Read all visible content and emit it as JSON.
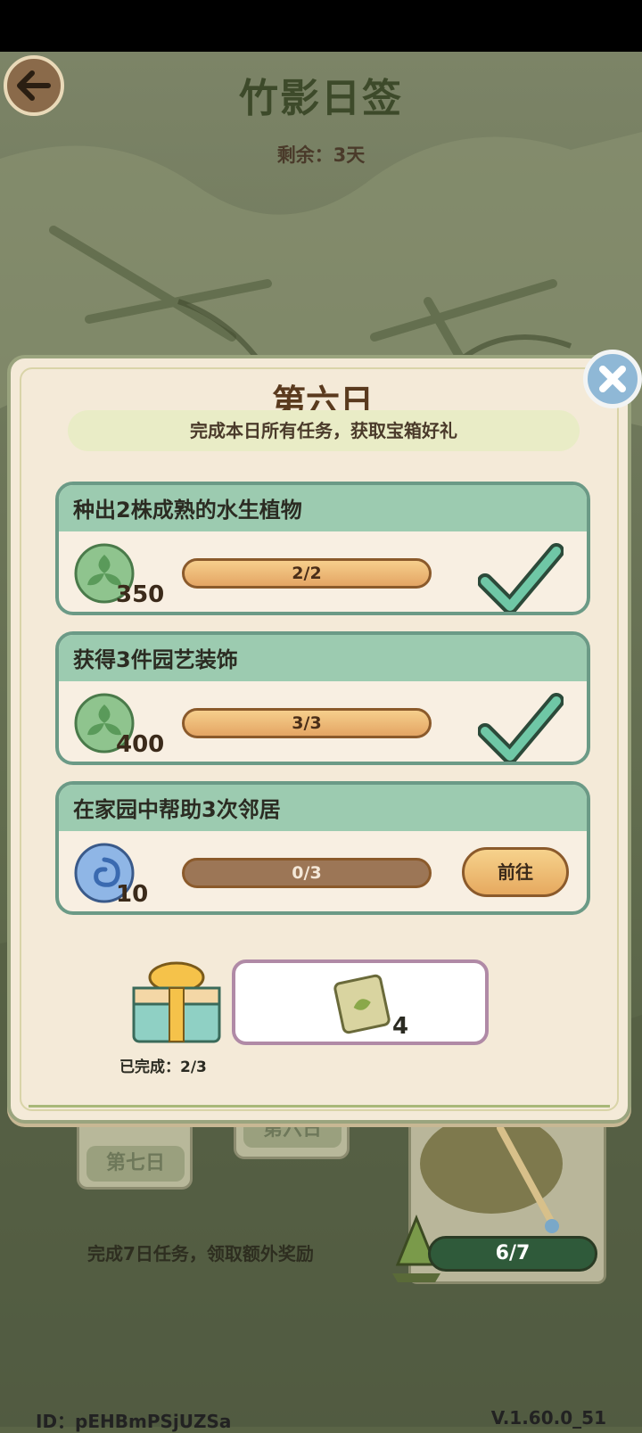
{
  "header": {
    "title": "竹影日签",
    "remaining_label": "剩余：3天"
  },
  "dialog": {
    "title": "第六日",
    "subtitle": "完成本日所有任务，获取宝箱好礼",
    "tasks": [
      {
        "title": "种出2株成熟的水生植物",
        "reward_icon": "leaf-coin-icon",
        "reward_amount": "350",
        "progress_text": "2/2",
        "progress_fraction": 1.0,
        "status": "completed"
      },
      {
        "title": "获得3件园艺装饰",
        "reward_icon": "leaf-coin-icon",
        "reward_amount": "400",
        "progress_text": "3/3",
        "progress_fraction": 1.0,
        "status": "completed"
      },
      {
        "title": "在家园中帮助3次邻居",
        "reward_icon": "swirl-orb-icon",
        "reward_amount": "10",
        "progress_text": "0/3",
        "progress_fraction": 0.0,
        "status": "go",
        "go_label": "前往"
      }
    ],
    "chest": {
      "completed_label": "已完成：2/3",
      "reward_icon": "seed-packet-icon",
      "reward_amount": "4"
    }
  },
  "background": {
    "day_cards": [
      "第七日",
      "第六日"
    ],
    "extra_reward_text": "完成7日任务，领取额外奖励",
    "week_progress": "6/7"
  },
  "footer": {
    "user_id": "ID：pEHBmPSjUZSa",
    "version": "V.1.60.0_51"
  },
  "colors": {
    "accent_green": "#9ccbb0",
    "border_green": "#6b9a86",
    "progress_fill": "#e4a564",
    "check_color": "#6fc7a6"
  }
}
